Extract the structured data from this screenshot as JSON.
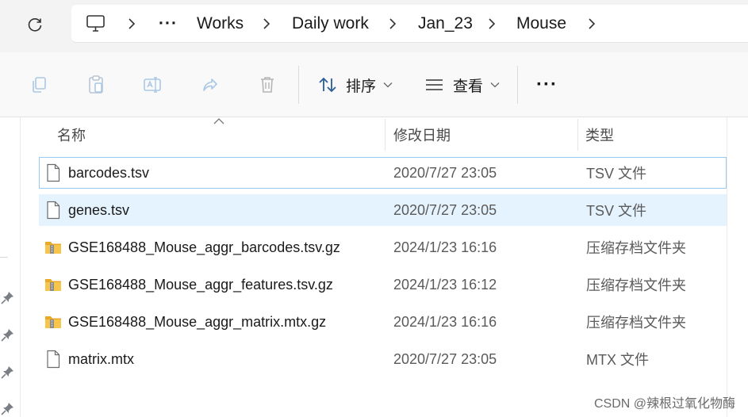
{
  "address_bar": {
    "breadcrumb": [
      "Works",
      "Daily work",
      "Jan_23",
      "Mouse"
    ],
    "overflow_label": "···"
  },
  "command_bar": {
    "sort_label": "排序",
    "view_label": "查看",
    "more_label": "···"
  },
  "columns": {
    "name": "名称",
    "modified": "修改日期",
    "type": "类型"
  },
  "files": [
    {
      "name": "barcodes.tsv",
      "modified": "2020/7/27 23:05",
      "type": "TSV 文件",
      "icon": "document-icon"
    },
    {
      "name": "genes.tsv",
      "modified": "2020/7/27 23:05",
      "type": "TSV 文件",
      "icon": "document-icon"
    },
    {
      "name": "GSE168488_Mouse_aggr_barcodes.tsv.gz",
      "modified": "2024/1/23 16:16",
      "type": "压缩存档文件夹",
      "icon": "zip-folder-icon"
    },
    {
      "name": "GSE168488_Mouse_aggr_features.tsv.gz",
      "modified": "2024/1/23 16:12",
      "type": "压缩存档文件夹",
      "icon": "zip-folder-icon"
    },
    {
      "name": "GSE168488_Mouse_aggr_matrix.mtx.gz",
      "modified": "2024/1/23 16:16",
      "type": "压缩存档文件夹",
      "icon": "zip-folder-icon"
    },
    {
      "name": "matrix.mtx",
      "modified": "2020/7/27 23:05",
      "type": "MTX 文件",
      "icon": "document-icon"
    }
  ],
  "watermark": "CSDN @辣根过氧化物酶",
  "colors": {
    "selection": "#e5f3ff",
    "focus_border": "#99c9ef",
    "zip_folder": "#f2c14e"
  }
}
